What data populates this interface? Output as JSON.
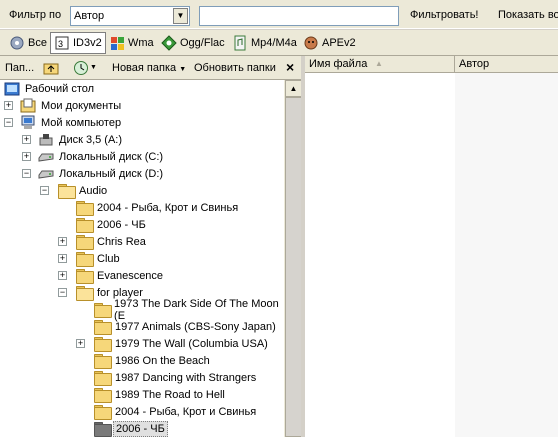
{
  "filterbar": {
    "filter_label": "Фильтр по",
    "filter_field_value": "Автор",
    "search_value": "",
    "filter_button": "Фильтровать!",
    "show_all": "Показать во"
  },
  "tabs": [
    {
      "label": "Все",
      "icon": "all-files-icon"
    },
    {
      "label": "ID3v2",
      "icon": "id3-icon"
    },
    {
      "label": "Wma",
      "icon": "windows-media-icon"
    },
    {
      "label": "Ogg/Flac",
      "icon": "ogg-icon"
    },
    {
      "label": "Mp4/M4a",
      "icon": "mp4-icon"
    },
    {
      "label": "APEv2",
      "icon": "ape-icon"
    }
  ],
  "lefttoolbar": {
    "folders_label": "Пап...",
    "new_folder": "Новая папка",
    "refresh_folders": "Обновить папки",
    "close": "×"
  },
  "tree": [
    {
      "label": "Рабочий стол",
      "icon": "desktop"
    },
    {
      "label": "Мои документы",
      "icon": "documents"
    },
    {
      "label": "Мой компьютер",
      "icon": "computer"
    },
    {
      "label": "Диск 3,5 (A:)",
      "icon": "floppy"
    },
    {
      "label": "Локальный диск (C:)",
      "icon": "drive"
    },
    {
      "label": "Локальный диск (D:)",
      "icon": "drive"
    },
    {
      "label": "Audio",
      "icon": "folder-open"
    },
    {
      "label": "2004 - Рыба, Крот и Свинья",
      "icon": "folder"
    },
    {
      "label": "2006 - ЧБ",
      "icon": "folder"
    },
    {
      "label": "Chris Rea",
      "icon": "folder"
    },
    {
      "label": "Club",
      "icon": "folder"
    },
    {
      "label": "Evanescence",
      "icon": "folder"
    },
    {
      "label": "for player",
      "icon": "folder-open"
    },
    {
      "label": "1973 The Dark Side Of The Moon (E",
      "icon": "folder"
    },
    {
      "label": "1977 Animals (CBS-Sony Japan)",
      "icon": "folder"
    },
    {
      "label": "1979 The Wall (Columbia USA)",
      "icon": "folder"
    },
    {
      "label": "1986 On the Beach",
      "icon": "folder"
    },
    {
      "label": "1987 Dancing with Strangers",
      "icon": "folder"
    },
    {
      "label": "1989 The Road to Hell",
      "icon": "folder"
    },
    {
      "label": "2004 - Рыба, Крот и Свинья",
      "icon": "folder"
    },
    {
      "label": "2006 - ЧБ",
      "icon": "folder-selected"
    }
  ],
  "filelist": {
    "col_filename": "Имя файла",
    "col_author": "Автор"
  },
  "colors": {
    "toolbar": "#ece9d8",
    "selection": "#e0e0e0",
    "folder": "#f6d77a"
  }
}
